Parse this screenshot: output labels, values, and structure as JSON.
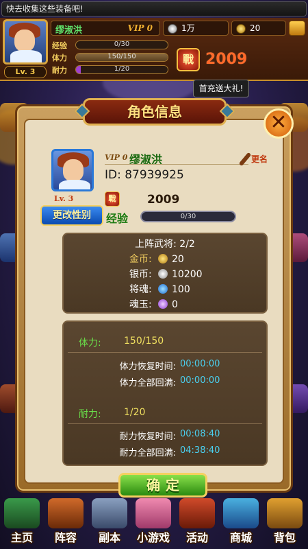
{
  "notice": {
    "text": "快去收集这些装备吧!"
  },
  "player": {
    "name": "缪淑洪",
    "vip": "VIP 0",
    "level": "Lv. 3",
    "silver": "1万",
    "gold": "20",
    "exp_label": "经验",
    "exp_text": "0/30",
    "exp_fraction": 0,
    "stamina_label": "体力",
    "stamina_text": "150/150",
    "stamina_fraction": 1,
    "endurance_label": "耐力",
    "endurance_text": "1/20",
    "endurance_fraction": 0.05,
    "power_icon_text": "戰",
    "power": "2009"
  },
  "gift_tip": "首充送大礼!",
  "dialog": {
    "title": "角色信息",
    "close_label": "✕",
    "vip": "VIP 0",
    "name": "缪淑洪",
    "rename_label": "更名",
    "id_text": "ID:  87939925",
    "level": "Lv. 3",
    "gender_button": "更改性别",
    "power_icon_text": "戰",
    "power": "2009",
    "exp_label": "经验",
    "exp_text": "0/30",
    "exp_fraction": 0,
    "generals": "上阵武将: 2/2",
    "resources": [
      {
        "label": "金币:",
        "icon": "gold-coin-icon",
        "value": "20"
      },
      {
        "label": "银币:",
        "icon": "silver-coin-icon",
        "value": "10200"
      },
      {
        "label": "将魂:",
        "icon": "soul-icon",
        "value": "100"
      },
      {
        "label": "魂玉:",
        "icon": "jade-icon",
        "value": "0"
      }
    ],
    "stamina": {
      "title": "体力:",
      "value": "150/150",
      "recover_label": "体力恢复时间:",
      "recover_value": "00:00:00",
      "full_label": "体力全部回满:",
      "full_value": "00:00:00"
    },
    "endurance": {
      "title": "耐力:",
      "value": "1/20",
      "recover_label": "耐力恢复时间:",
      "recover_value": "00:08:40",
      "full_label": "耐力全部回满:",
      "full_value": "04:38:40"
    },
    "ok_label": "确定"
  },
  "nav": [
    {
      "label": "主页",
      "icon": "home-icon"
    },
    {
      "label": "阵容",
      "icon": "lineup-icon"
    },
    {
      "label": "副本",
      "icon": "dungeon-icon"
    },
    {
      "label": "小游戏",
      "icon": "minigame-icon"
    },
    {
      "label": "活动",
      "icon": "event-icon"
    },
    {
      "label": "商城",
      "icon": "shop-icon"
    },
    {
      "label": "背包",
      "icon": "bag-icon"
    }
  ],
  "colors": {
    "green_name": "#1a6a10",
    "time_cyan": "#4ad0f0",
    "power_red": "#ff6a2a"
  }
}
